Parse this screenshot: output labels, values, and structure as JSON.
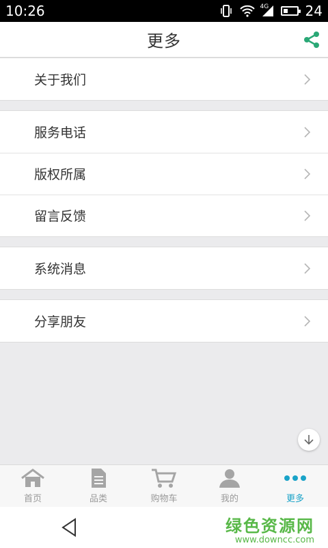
{
  "status_bar": {
    "time": "10:26",
    "network": "4G",
    "battery": "24"
  },
  "header": {
    "title": "更多"
  },
  "menu_groups": [
    [
      {
        "label": "关于我们"
      }
    ],
    [
      {
        "label": "服务电话"
      },
      {
        "label": "版权所属"
      },
      {
        "label": "留言反馈"
      }
    ],
    [
      {
        "label": "系统消息"
      }
    ],
    [
      {
        "label": "分享朋友"
      }
    ]
  ],
  "tabs": [
    {
      "label": "首页",
      "icon": "home-icon"
    },
    {
      "label": "品类",
      "icon": "document-icon"
    },
    {
      "label": "购物车",
      "icon": "cart-icon"
    },
    {
      "label": "我的",
      "icon": "user-icon"
    },
    {
      "label": "更多",
      "icon": "more-dots-icon",
      "active": true
    }
  ],
  "watermark": {
    "title": "绿色资源网",
    "url": "www.downcc.com"
  },
  "colors": {
    "accent": "#1aa3c8",
    "share": "#2aa876",
    "watermark": "#58b848"
  }
}
